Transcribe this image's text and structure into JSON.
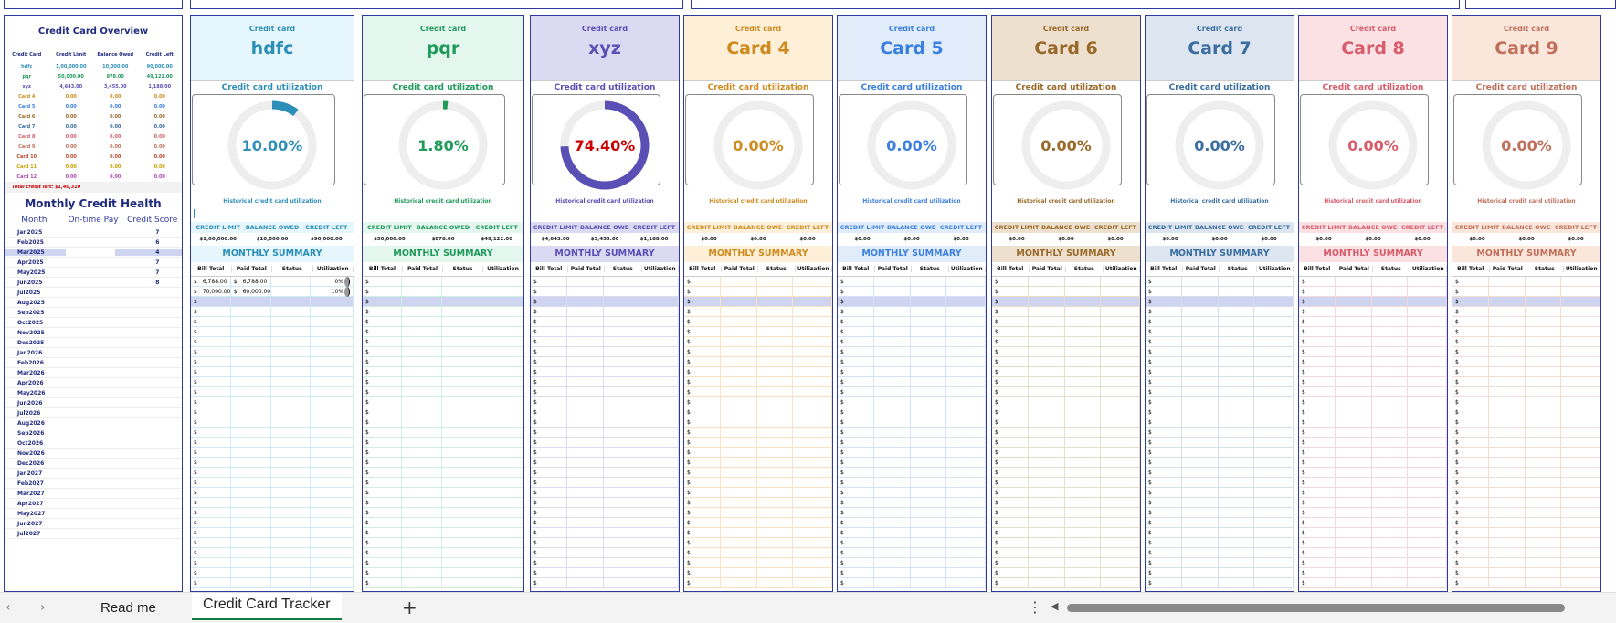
{
  "overview": {
    "title": "Credit Card Overview",
    "headers": [
      "Credit Card",
      "Credit Limit",
      "Balance Owed",
      "Credit Left"
    ],
    "rows": [
      {
        "name": "hdfc",
        "limit": "1,00,000.00",
        "owed": "10,000.00",
        "left": "90,000.00",
        "color": "#2d8fb8"
      },
      {
        "name": "pqr",
        "limit": "50,000.00",
        "owed": "878.00",
        "left": "49,122.00",
        "color": "#1f9a5a"
      },
      {
        "name": "xyz",
        "limit": "4,643.00",
        "owed": "3,455.00",
        "left": "1,188.00",
        "color": "#5a4fb5"
      },
      {
        "name": "Card 4",
        "limit": "0.00",
        "owed": "0.00",
        "left": "0.00",
        "color": "#d08a1e"
      },
      {
        "name": "Card 5",
        "limit": "0.00",
        "owed": "0.00",
        "left": "0.00",
        "color": "#3b7fe0"
      },
      {
        "name": "Card 6",
        "limit": "0.00",
        "owed": "0.00",
        "left": "0.00",
        "color": "#9a6a2a"
      },
      {
        "name": "Card 7",
        "limit": "0.00",
        "owed": "0.00",
        "left": "0.00",
        "color": "#3a6ea0"
      },
      {
        "name": "Card 8",
        "limit": "0.00",
        "owed": "0.00",
        "left": "0.00",
        "color": "#d85c6a"
      },
      {
        "name": "Card 9",
        "limit": "0.00",
        "owed": "0.00",
        "left": "0.00",
        "color": "#c0705a"
      },
      {
        "name": "Card 10",
        "limit": "0.00",
        "owed": "0.00",
        "left": "0.00",
        "color": "#c04a2a"
      },
      {
        "name": "Card 11",
        "limit": "0.00",
        "owed": "0.00",
        "left": "0.00",
        "color": "#c9a000"
      },
      {
        "name": "Card 12",
        "limit": "0.00",
        "owed": "0.00",
        "left": "0.00",
        "color": "#b04ab0"
      }
    ],
    "total": "Total credit left: $1,40,310",
    "health_title": "Monthly Credit Health",
    "health_headers": [
      "Month",
      "On-time Pay",
      "Credit Score"
    ],
    "months": [
      {
        "m": "Jan2025",
        "s": "7"
      },
      {
        "m": "Feb2025",
        "s": "6"
      },
      {
        "m": "Mar2025",
        "s": "4"
      },
      {
        "m": "Apr2025",
        "s": "7"
      },
      {
        "m": "May2025",
        "s": "7"
      },
      {
        "m": "Jun2025",
        "s": "8"
      },
      {
        "m": "Jul2025",
        "s": ""
      },
      {
        "m": "Aug2025",
        "s": ""
      },
      {
        "m": "Sep2025",
        "s": ""
      },
      {
        "m": "Oct2025",
        "s": ""
      },
      {
        "m": "Nov2025",
        "s": ""
      },
      {
        "m": "Dec2025",
        "s": ""
      },
      {
        "m": "Jan2026",
        "s": ""
      },
      {
        "m": "Feb2026",
        "s": ""
      },
      {
        "m": "Mar2026",
        "s": ""
      },
      {
        "m": "Apr2026",
        "s": ""
      },
      {
        "m": "May2026",
        "s": ""
      },
      {
        "m": "Jun2026",
        "s": ""
      },
      {
        "m": "Jul2026",
        "s": ""
      },
      {
        "m": "Aug2026",
        "s": ""
      },
      {
        "m": "Sep2026",
        "s": ""
      },
      {
        "m": "Oct2026",
        "s": ""
      },
      {
        "m": "Nov2026",
        "s": ""
      },
      {
        "m": "Dec2026",
        "s": ""
      },
      {
        "m": "Jan2027",
        "s": ""
      },
      {
        "m": "Feb2027",
        "s": ""
      },
      {
        "m": "Mar2027",
        "s": ""
      },
      {
        "m": "Apr2027",
        "s": ""
      },
      {
        "m": "May2027",
        "s": ""
      },
      {
        "m": "Jun2027",
        "s": ""
      },
      {
        "m": "Jul2027",
        "s": ""
      }
    ]
  },
  "labels": {
    "credit_card": "Credit card",
    "utilization": "Credit card utilization",
    "historical": "Historical credit card utilization",
    "monthly_summary": "MONTHLY SUMMARY",
    "sum_headers": [
      "CREDIT LIMIT",
      "BALANCE OWED",
      "CREDIT LEFT"
    ],
    "table_headers": [
      "Bill Total",
      "Paid Total",
      "Status",
      "Utilization"
    ],
    "dollar": "$"
  },
  "cards": [
    {
      "name": "hdfc",
      "util": "10.00%",
      "util_value": 0.1,
      "limit": "$1,00,000.00",
      "owed": "$10,000.00",
      "left": "$90,000.00",
      "accent": "#2d8fb8",
      "bg": "#e6f6fd",
      "row_line": "#cfeaf5",
      "val_color": "#2d8fb8",
      "bill": "6,788.00",
      "paid": "6,788.00",
      "bill2": "70,000.00",
      "paid2": "60,000.00",
      "u1": "0%",
      "u2": "10%"
    },
    {
      "name": "pqr",
      "util": "1.80%",
      "util_value": 0.018,
      "limit": "$50,000.00",
      "owed": "$878.00",
      "left": "$49,122.00",
      "accent": "#1f9a5a",
      "bg": "#e4f7ee",
      "row_line": "#cfeedf",
      "val_color": "#1f9a5a"
    },
    {
      "name": "xyz",
      "util": "74.40%",
      "util_value": 0.744,
      "limit": "$4,643.00",
      "owed": "$3,455.00",
      "left": "$1,188.00",
      "accent": "#5a4fb5",
      "bg": "#dcdaf2",
      "row_line": "#dcdcf0",
      "val_color": "#cc0000"
    },
    {
      "name": "Card 4",
      "util": "0.00%",
      "util_value": 0,
      "limit": "$0.00",
      "owed": "$0.00",
      "left": "$0.00",
      "accent": "#d08a1e",
      "bg": "#fdefd8",
      "row_line": "#f7e3c4",
      "val_color": "#d08a1e"
    },
    {
      "name": "Card 5",
      "util": "0.00%",
      "util_value": 0,
      "limit": "$0.00",
      "owed": "$0.00",
      "left": "$0.00",
      "accent": "#3b7fe0",
      "bg": "#e1ecfb",
      "row_line": "#d6e3f7",
      "val_color": "#3b7fe0"
    },
    {
      "name": "Card 6",
      "util": "0.00%",
      "util_value": 0,
      "limit": "$0.00",
      "owed": "$0.00",
      "left": "$0.00",
      "accent": "#9a6a2a",
      "bg": "#ede0cf",
      "row_line": "#e8dccb",
      "val_color": "#9a6a2a"
    },
    {
      "name": "Card 7",
      "util": "0.00%",
      "util_value": 0,
      "limit": "$0.00",
      "owed": "$0.00",
      "left": "$0.00",
      "accent": "#3a6ea0",
      "bg": "#dde6f0",
      "row_line": "#d6e0eb",
      "val_color": "#3a6ea0"
    },
    {
      "name": "Card 8",
      "util": "0.00%",
      "util_value": 0,
      "limit": "$0.00",
      "owed": "$0.00",
      "left": "$0.00",
      "accent": "#d85c6a",
      "bg": "#fbe1e4",
      "row_line": "#f5d8dc",
      "val_color": "#d85c6a"
    },
    {
      "name": "Card 9",
      "util": "0.00%",
      "util_value": 0,
      "limit": "$0.00",
      "owed": "$0.00",
      "left": "$0.00",
      "accent": "#c0705a",
      "bg": "#fbe6dc",
      "row_line": "#f3dcd2",
      "val_color": "#c0705a"
    }
  ],
  "tabs": {
    "sheet1": "Read me",
    "sheet2": "Credit Card Tracker",
    "add": "+",
    "more": "⋮",
    "prev": "‹",
    "next": "›",
    "scroll_left": "◀"
  }
}
